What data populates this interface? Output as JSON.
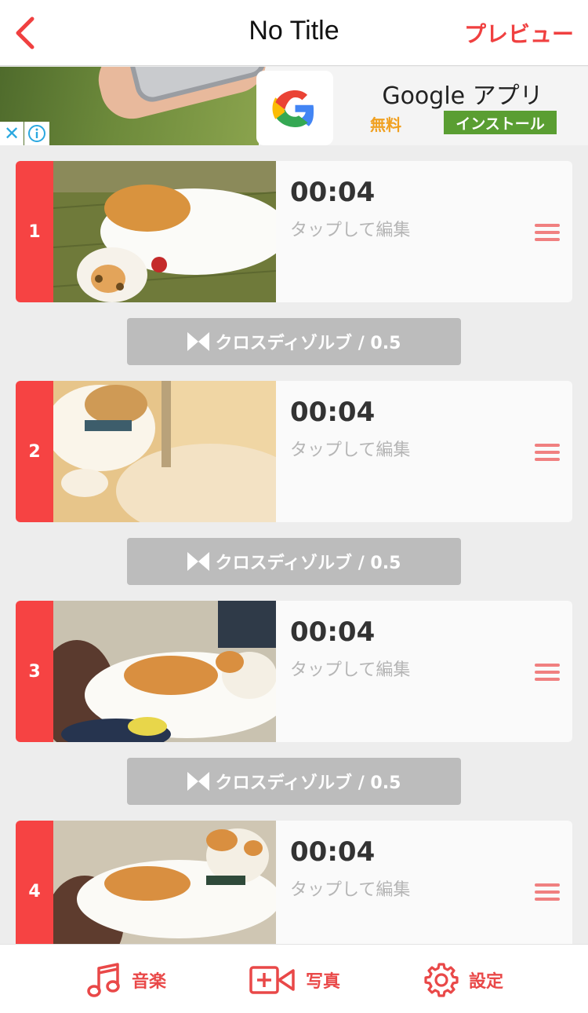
{
  "header": {
    "title": "No Title",
    "preview_label": "プレビュー"
  },
  "ad": {
    "app_name": "Google アプリ",
    "price": "無料",
    "install_label": "インストール",
    "close_glyph": "✕"
  },
  "clips": [
    {
      "number": "1",
      "duration": "00:04",
      "hint": "タップして編集"
    },
    {
      "number": "2",
      "duration": "00:04",
      "hint": "タップして編集"
    },
    {
      "number": "3",
      "duration": "00:04",
      "hint": "タップして編集"
    },
    {
      "number": "4",
      "duration": "00:04",
      "hint": "タップして編集"
    }
  ],
  "transitions": [
    {
      "label": "クロスディゾルブ / 0.5"
    },
    {
      "label": "クロスディゾルブ / 0.5"
    },
    {
      "label": "クロスディゾルブ / 0.5"
    }
  ],
  "toolbar": {
    "music_label": "音楽",
    "photo_label": "写真",
    "settings_label": "設定"
  },
  "colors": {
    "accent": "#f64343",
    "ad_install": "#5a9e32",
    "transition": "#bcbcbc"
  }
}
